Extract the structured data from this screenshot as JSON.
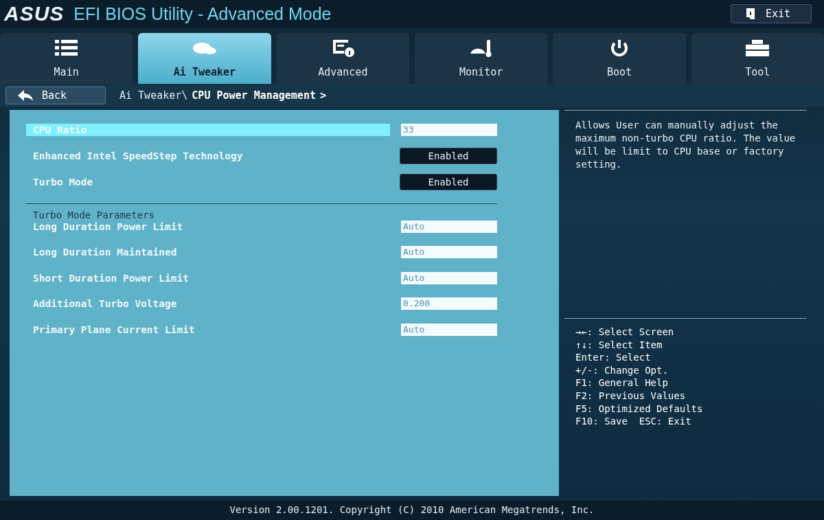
{
  "header": {
    "logo": "ASUS",
    "title": "EFI BIOS Utility - Advanced Mode",
    "exit_label": "Exit"
  },
  "tabs": [
    {
      "label": "Main",
      "selected": false
    },
    {
      "label": "Ai Tweaker",
      "selected": true
    },
    {
      "label": "Advanced",
      "selected": false
    },
    {
      "label": "Monitor",
      "selected": false
    },
    {
      "label": "Boot",
      "selected": false
    },
    {
      "label": "Tool",
      "selected": false
    }
  ],
  "back_label": "Back",
  "breadcrumb": {
    "path": "Ai Tweaker\\",
    "current": "CPU Power Management",
    "arrow": ">"
  },
  "settings": [
    {
      "label": "CPU Ratio",
      "value": "33",
      "kind": "field",
      "selected": true
    },
    {
      "label": "Enhanced Intel SpeedStep Technology",
      "value": "Enabled",
      "kind": "option",
      "selected": false
    },
    {
      "label": "Turbo Mode",
      "value": "Enabled",
      "kind": "option",
      "selected": false
    }
  ],
  "turbo_section": {
    "title": "Turbo Mode Parameters",
    "settings": [
      {
        "label": "Long Duration Power Limit",
        "value": "Auto",
        "kind": "field",
        "selected": false
      },
      {
        "label": "Long Duration Maintained",
        "value": "Auto",
        "kind": "field",
        "selected": false
      },
      {
        "label": "Short Duration Power Limit",
        "value": "Auto",
        "kind": "field",
        "selected": false
      },
      {
        "label": "Additional Turbo Voltage",
        "value": "0.200",
        "kind": "field",
        "selected": false
      },
      {
        "label": "Primary Plane Current Limit",
        "value": "Auto",
        "kind": "field",
        "selected": false
      }
    ]
  },
  "help_text": "Allows User can manually adjust the maximum non-turbo CPU ratio. The value will be limit to CPU base or factory setting.",
  "key_hints": [
    "→←: Select Screen",
    "↑↓: Select Item",
    "Enter: Select",
    "+/-: Change Opt.",
    "F1: General Help",
    "F2: Previous Values",
    "F5: Optimized Defaults",
    "F10: Save  ESC: Exit"
  ],
  "footer": "Version 2.00.1201. Copyright (C) 2010 American Megatrends, Inc."
}
